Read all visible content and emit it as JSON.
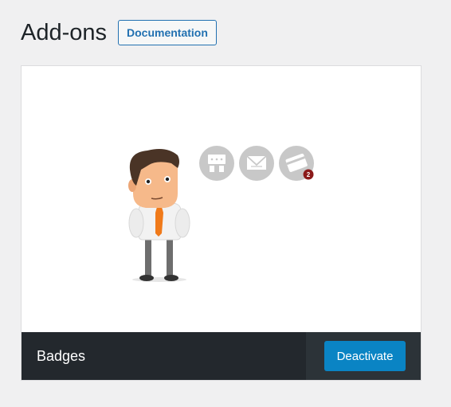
{
  "page": {
    "title": "Add-ons",
    "documentation_label": "Documentation"
  },
  "addon": {
    "name": "Badges",
    "action_label": "Deactivate",
    "badge_count": "2",
    "icons": [
      "presentation-icon",
      "mail-icon",
      "credit-card-icon"
    ]
  },
  "colors": {
    "accent": "#2271b1",
    "action_button": "#0a84c4",
    "footer": "#23282d",
    "notification_badge": "#8b1a1a"
  }
}
